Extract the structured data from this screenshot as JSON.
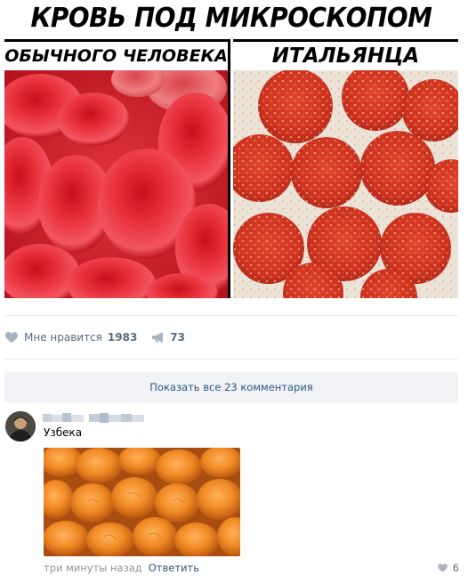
{
  "meme": {
    "title": "КРОВЬ ПОД МИКРОСКОПОМ",
    "left_caption": "ОБЫЧНОГО ЧЕЛОВЕКА",
    "right_caption": "ИТАЛЬЯНЦА"
  },
  "post": {
    "like_label": "Мне нравится",
    "like_count": "1983",
    "share_count": "73"
  },
  "comments": {
    "show_all_label": "Показать все 23 комментария",
    "items": [
      {
        "text": "Узбека",
        "time": "три минуты назад",
        "reply_label": "Ответить",
        "like_count": "6"
      }
    ]
  },
  "colors": {
    "link": "#2a5885",
    "muted": "#939393",
    "action": "#5b6b7d",
    "button_bg": "#f0f2f5",
    "divider": "#e7e8ec"
  }
}
